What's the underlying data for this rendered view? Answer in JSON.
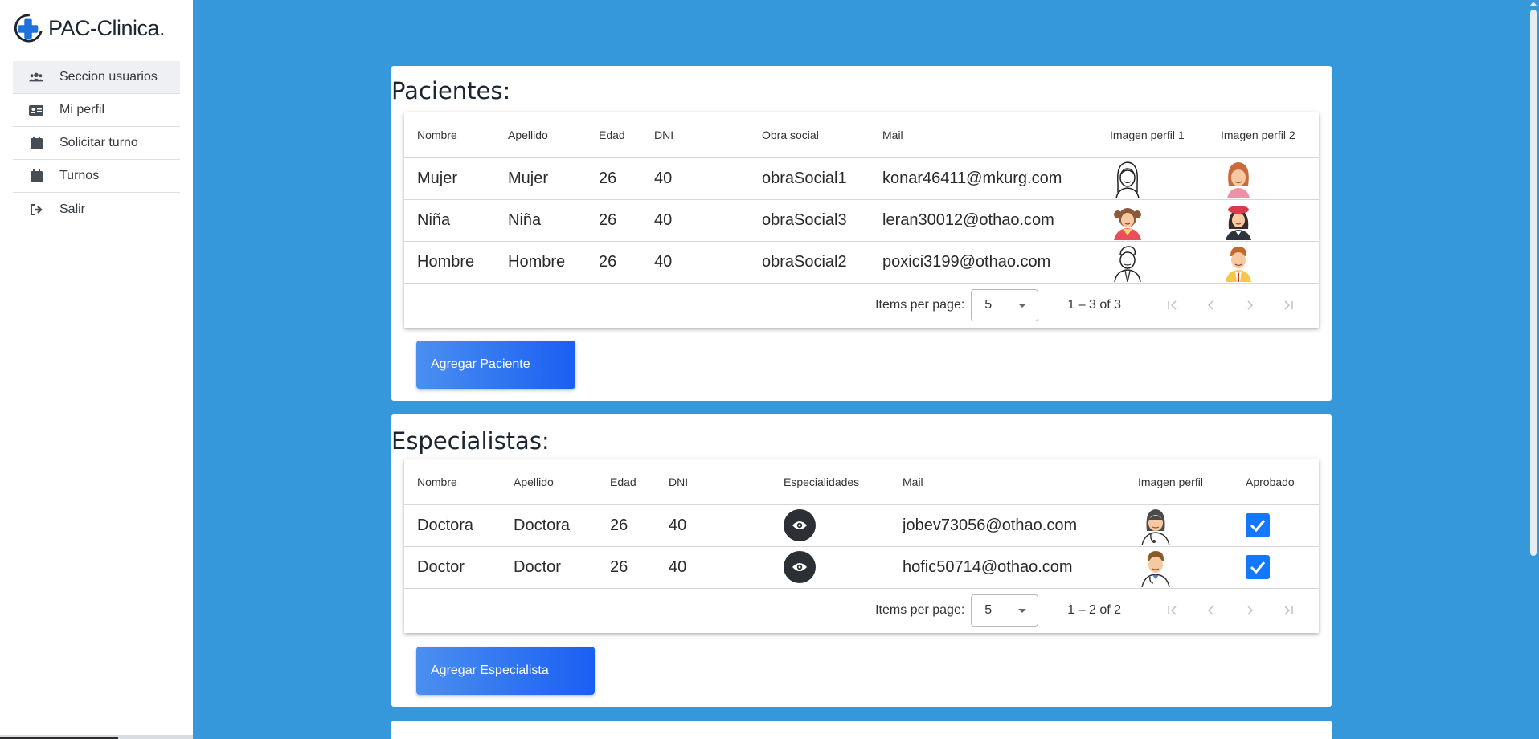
{
  "app": {
    "title": "PAC-Clinica."
  },
  "sidebar": {
    "items": [
      {
        "label": "Seccion usuarios",
        "icon": "users-icon"
      },
      {
        "label": "Mi perfil",
        "icon": "id-card-icon"
      },
      {
        "label": "Solicitar turno",
        "icon": "calendar-icon"
      },
      {
        "label": "Turnos",
        "icon": "calendar-icon"
      },
      {
        "label": "Salir",
        "icon": "sign-out-icon"
      }
    ]
  },
  "pacientes": {
    "title": "Pacientes:",
    "columns": [
      "Nombre",
      "Apellido",
      "Edad",
      "DNI",
      "Obra social",
      "Mail",
      "Imagen perfil 1",
      "Imagen perfil 2"
    ],
    "rows": [
      {
        "nombre": "Mujer",
        "apellido": "Mujer",
        "edad": "26",
        "dni": "40",
        "obra": "obraSocial1",
        "mail": "konar46411@mkurg.com"
      },
      {
        "nombre": "Niña",
        "apellido": "Niña",
        "edad": "26",
        "dni": "40",
        "obra": "obraSocial3",
        "mail": "leran30012@othao.com"
      },
      {
        "nombre": "Hombre",
        "apellido": "Hombre",
        "edad": "26",
        "dni": "40",
        "obra": "obraSocial2",
        "mail": "poxici3199@othao.com"
      }
    ],
    "paginator": {
      "label": "Items per page:",
      "size": "5",
      "range": "1 – 3 of 3"
    },
    "add_label": "Agregar Paciente"
  },
  "especialistas": {
    "title": "Especialistas:",
    "columns": [
      "Nombre",
      "Apellido",
      "Edad",
      "DNI",
      "Especialidades",
      "Mail",
      "Imagen perfil",
      "Aprobado"
    ],
    "rows": [
      {
        "nombre": "Doctora",
        "apellido": "Doctora",
        "edad": "26",
        "dni": "40",
        "mail": "jobev73056@othao.com",
        "aprobado": true
      },
      {
        "nombre": "Doctor",
        "apellido": "Doctor",
        "edad": "26",
        "dni": "40",
        "mail": "hofic50714@othao.com",
        "aprobado": true
      }
    ],
    "paginator": {
      "label": "Items per page:",
      "size": "5",
      "range": "1 – 2 of 2"
    },
    "add_label": "Agregar Especialista"
  },
  "colors": {
    "background": "#3498db",
    "button": "#1a5ff2",
    "checkbox": "#1478ff"
  }
}
